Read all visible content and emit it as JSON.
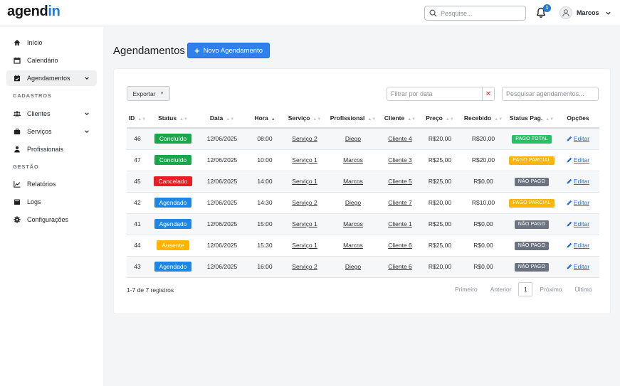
{
  "header": {
    "logo_main": "agend",
    "logo_accent": "in",
    "search_placeholder": "Pesquise...",
    "notifications_count": "1",
    "user_name": "Marcos"
  },
  "sidebar": {
    "items": [
      {
        "label": "Início",
        "icon": "home-icon"
      },
      {
        "label": "Calendário",
        "icon": "calendar-icon"
      },
      {
        "label": "Agendamentos",
        "icon": "calendar-check-icon"
      },
      {
        "label": "Clientes",
        "icon": "users-icon"
      },
      {
        "label": "Serviços",
        "icon": "briefcase-icon"
      },
      {
        "label": "Profissionais",
        "icon": "user-icon"
      },
      {
        "label": "Relatórios",
        "icon": "chart-line-icon"
      },
      {
        "label": "Logs",
        "icon": "inbox-icon"
      },
      {
        "label": "Configurações",
        "icon": "gear-icon"
      }
    ],
    "sections": {
      "cadastros": "CADASTROS",
      "gestao": "GESTÃO"
    }
  },
  "main": {
    "title": "Agendamentos",
    "new_button": "Novo Agendamento",
    "export_button": "Exportar",
    "date_filter_placeholder": "Filtrar por data",
    "table_search_placeholder": "Pesquisar agendamentos...",
    "columns": [
      "ID",
      "Status",
      "Data",
      "Hora",
      "Serviço",
      "Profissional",
      "Cliente",
      "Preço",
      "Recebido",
      "Status Pag.",
      "Opções"
    ],
    "rows": [
      {
        "id": "46",
        "status": "Concluído",
        "date": "12/06/2025",
        "time": "08:00",
        "service": "Serviço 2",
        "professional": "Diego",
        "client": "Cliente 4",
        "price": "R$20,00",
        "received": "R$20,00",
        "pay_status": "PAGO TOTAL",
        "action": "Editar"
      },
      {
        "id": "47",
        "status": "Concluído",
        "date": "12/06/2025",
        "time": "10:00",
        "service": "Serviço 1",
        "professional": "Marcos",
        "client": "Cliente 3",
        "price": "R$25,00",
        "received": "R$20,00",
        "pay_status": "PAGO PARCIAL",
        "action": "Editar"
      },
      {
        "id": "45",
        "status": "Cancelado",
        "date": "12/06/2025",
        "time": "14:00",
        "service": "Serviço 1",
        "professional": "Marcos",
        "client": "Cliente 5",
        "price": "R$25,00",
        "received": "R$0,00",
        "pay_status": "NÃO PAGO",
        "action": "Editar"
      },
      {
        "id": "42",
        "status": "Agendado",
        "date": "12/06/2025",
        "time": "14:30",
        "service": "Serviço 2",
        "professional": "Diego",
        "client": "Cliente 7",
        "price": "R$20,00",
        "received": "R$10,00",
        "pay_status": "PAGO PARCIAL",
        "action": "Editar"
      },
      {
        "id": "41",
        "status": "Agendado",
        "date": "12/06/2025",
        "time": "15:00",
        "service": "Serviço 1",
        "professional": "Marcos",
        "client": "Cliente 1",
        "price": "R$25,00",
        "received": "R$0,00",
        "pay_status": "NÃO PAGO",
        "action": "Editar"
      },
      {
        "id": "44",
        "status": "Ausente",
        "date": "12/06/2025",
        "time": "15:30",
        "service": "Serviço 1",
        "professional": "Marcos",
        "client": "Cliente 6",
        "price": "R$25,00",
        "received": "R$0,00",
        "pay_status": "NÃO PAGO",
        "action": "Editar"
      },
      {
        "id": "43",
        "status": "Agendado",
        "date": "12/06/2025",
        "time": "16:00",
        "service": "Serviço 2",
        "professional": "Diego",
        "client": "Cliente 6",
        "price": "R$20,00",
        "received": "R$0,00",
        "pay_status": "NÃO PAGO",
        "action": "Editar"
      }
    ],
    "footer_count": "1-7 de 7 registros",
    "pagination": {
      "first": "Primeiro",
      "prev": "Anterior",
      "current": "1",
      "next": "Próximo",
      "last": "Último"
    }
  },
  "colors": {
    "accent": "#1f7ae0",
    "concluido": "#1aa64b",
    "cancelado": "#ec1c24",
    "agendado": "#1f86e6",
    "ausente": "#ffb400"
  }
}
